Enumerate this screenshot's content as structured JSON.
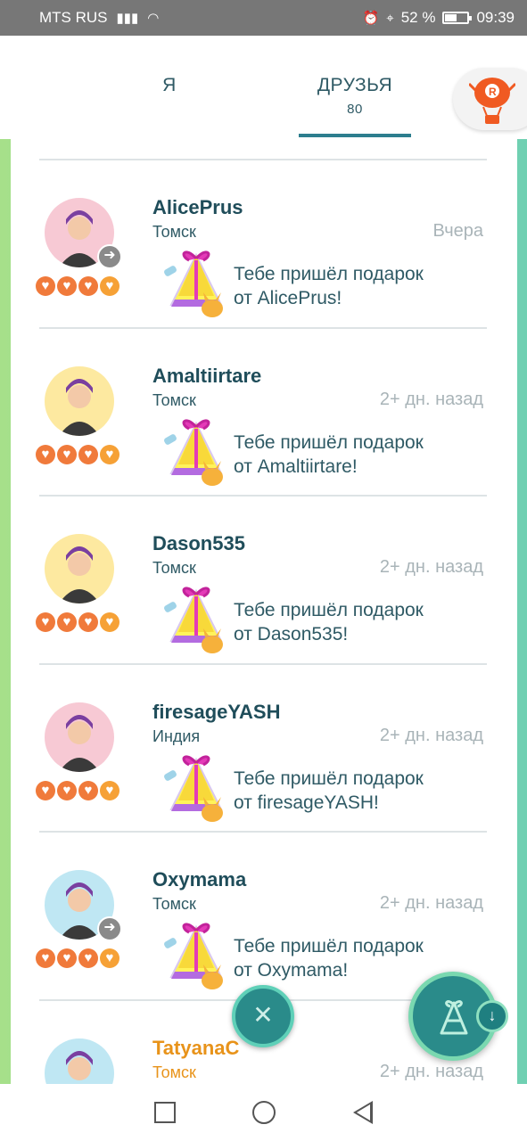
{
  "status_bar": {
    "carrier": "MTS RUS",
    "battery_percent": "52 %",
    "battery_level": 0.52,
    "time": "09:39"
  },
  "tabs": {
    "me_label": "Я",
    "friends_label": "ДРУЗЬЯ",
    "friends_count": "80"
  },
  "friends": [
    {
      "name": "AlicePrus",
      "city": "Томск",
      "time": "Вчера",
      "message_line1": "Тебе пришёл подарок",
      "message_line2": "от AlicePrus!",
      "avatar_bg": "#f7c9d4",
      "has_arrow": true
    },
    {
      "name": "Amaltiirtare",
      "city": "Томск",
      "time": "2+ дн. назад",
      "message_line1": "Тебе пришёл подарок",
      "message_line2": "от Amaltiirtare!",
      "avatar_bg": "#fde9a0",
      "has_arrow": false
    },
    {
      "name": "Dason535",
      "city": "Томск",
      "time": "2+ дн. назад",
      "message_line1": "Тебе пришёл подарок",
      "message_line2": "от Dason535!",
      "avatar_bg": "#fde9a0",
      "has_arrow": false
    },
    {
      "name": "firesageYASH",
      "city": "Индия",
      "time": "2+ дн. назад",
      "message_line1": "Тебе пришёл подарок",
      "message_line2": "от firesageYASH!",
      "avatar_bg": "#f7c9d4",
      "has_arrow": false
    },
    {
      "name": "Oxymama",
      "city": "Томск",
      "time": "2+ дн. назад",
      "message_line1": "Тебе пришёл подарок",
      "message_line2": "от Oxymama!",
      "avatar_bg": "#bfe7f3",
      "has_arrow": true
    },
    {
      "name": "TatyanaC",
      "city": "Томск",
      "time": "2+ дн. назад",
      "message_line1": "",
      "message_line2": "",
      "avatar_bg": "#bfe7f3",
      "has_arrow": false
    }
  ],
  "colors": {
    "accent": "#2d7e8e",
    "heart": "#f07a3b",
    "best_friend_name": "#e8931a"
  },
  "icons": {
    "balloon": "team-rocket-balloon-icon",
    "close": "close-icon",
    "gift": "gift-icon",
    "download": "download-icon"
  }
}
